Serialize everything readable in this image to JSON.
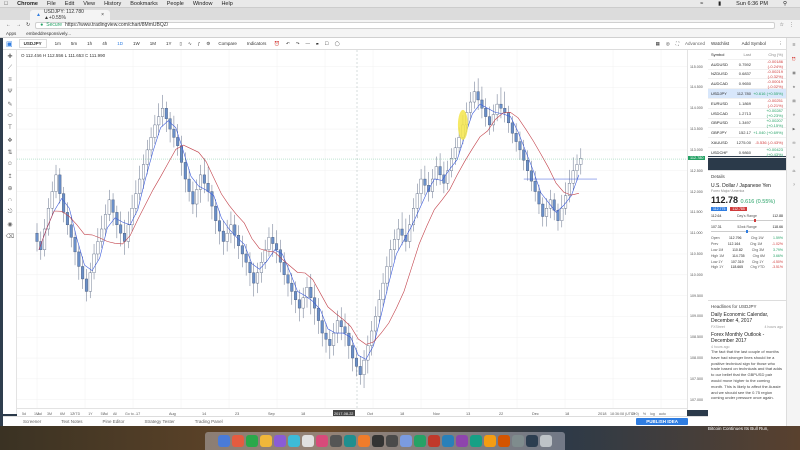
{
  "menubar": {
    "items": [
      "Chrome",
      "File",
      "Edit",
      "View",
      "History",
      "Bookmarks",
      "People",
      "Window",
      "Help"
    ],
    "clock": "Sun 6:36 PM"
  },
  "browser": {
    "tab_title": "USDJPY: 112.780 ▲+0.55%",
    "url_secure": "Secure",
    "url": "https://www.tradingview.com/chart/8MmUBQZ/",
    "bookmarks": [
      "Apps",
      "embeddresponsively..."
    ]
  },
  "toolbar": {
    "symbol": "USDJPY",
    "intervals": [
      "1m",
      "5m",
      "1h",
      "4h",
      "1D",
      "1W",
      "1M",
      "1Y"
    ],
    "compare": "Compare",
    "indicators": "Indicators",
    "advanced": "Advanced"
  },
  "ohlc": "O 112.456  H 112.556  L 111.653  C 111.990",
  "timeline": {
    "labels": [
      "Jul",
      "12",
      "Jul",
      "17",
      "Aug",
      "14",
      "23",
      "Sep",
      "18",
      "2017-08-22",
      "Oct",
      "18",
      "Nov",
      "13",
      "22",
      "Dec",
      "18",
      "2018",
      "15"
    ],
    "ranges": [
      "5d",
      "1M",
      "3M",
      "6M",
      "YTD",
      "1Y",
      "5Y",
      "All",
      "Go to..."
    ],
    "clock_readout": "18:36:08 (UTC+0)",
    "scale_opts": [
      "%",
      "log",
      "auto"
    ]
  },
  "price_axis": [
    "115.000",
    "114.500",
    "114.000",
    "113.500",
    "113.000",
    "112.500",
    "112.000",
    "111.500",
    "111.000",
    "110.500",
    "110.000",
    "109.500",
    "109.000",
    "108.500",
    "108.000",
    "107.500",
    "107.000"
  ],
  "price_tag": "112.780",
  "bottombar": {
    "items": [
      "Screener",
      "Text Notes",
      "Pine Editor",
      "Strategy Tester",
      "Trading Panel"
    ],
    "publish": "PUBLISH IDEA"
  },
  "watchlist": {
    "title": "Watchlist",
    "add": "Add Symbol",
    "headers": [
      "Symbol",
      "Last",
      "Chg (%)"
    ],
    "rows": [
      {
        "s": "AUDUSD",
        "l": "0.7592",
        "c": "-0.00186 (-0.24%)",
        "pos": false
      },
      {
        "s": "NZDUSD",
        "l": "0.6837",
        "c": "-0.00219 (-0.32%)",
        "pos": false
      },
      {
        "s": "AUDCAD",
        "l": "0.9650",
        "c": "-0.00019 (-0.02%)",
        "pos": false
      },
      {
        "s": "USDJPY",
        "l": "112.780",
        "c": "+0.616 (+0.55%)",
        "pos": true,
        "sel": true
      },
      {
        "s": "EURUSD",
        "l": "1.1869",
        "c": "-0.00251 (-0.21%)",
        "pos": false
      },
      {
        "s": "USDCAD",
        "l": "1.2713",
        "c": "+0.00287 (+0.23%)",
        "pos": true
      },
      {
        "s": "GBPUSD",
        "l": "1.3497",
        "c": "+0.00207 (+0.15%)",
        "pos": true
      },
      {
        "s": "GBPJPY",
        "l": "152.17",
        "c": "+1.040 (+0.69%)",
        "pos": true
      },
      {
        "s": "XAUUSD",
        "l": "1275.00",
        "c": "-5.536 (-0.43%)",
        "pos": false
      },
      {
        "s": "USDCHF",
        "l": "0.9860",
        "c": "+0.00423 (+0.43%)",
        "pos": true
      }
    ]
  },
  "details": {
    "title": "Details",
    "name": "U.S. Dollar / Japanese Yen",
    "exchange": "Forex Major/ America",
    "price": "112.78",
    "change": "0.616 (0.55%)",
    "bid": "112.775",
    "ask": "112.785",
    "day_low": "112.64",
    "day_high": "112.88",
    "day_range_label": "Day's Range",
    "yr_low": "107.31",
    "yr_high": "118.66",
    "yr_range_label": "52wk Range",
    "stats": [
      [
        "Open",
        "112.796",
        "Chg 1W",
        "1.59%"
      ],
      [
        "Prev",
        "112.164",
        "Chg 1M",
        "-1.02%"
      ],
      [
        "Low 1M",
        "110.82",
        "Chg 3M",
        "3.79%"
      ],
      [
        "High 1M",
        "114.735",
        "Chg 6M",
        "3.66%"
      ],
      [
        "Low 1Y",
        "107.319",
        "Chg 1Y",
        "-4.50%"
      ],
      [
        "High 1Y",
        "118.665",
        "Chg YTD",
        "-3.51%"
      ]
    ]
  },
  "headlines": {
    "title": "Headlines for USDJPY",
    "items": [
      {
        "t": "Daily Economic Calendar, December 4, 2017",
        "src": "FXStreet",
        "ago": "4 hours ago"
      },
      {
        "t": "Forex Monthly Outlook - December 2017",
        "src": "",
        "ago": "4 hours ago",
        "body": "The fact that the last couple of months have had stronger lines should be a positive technical sign for those who trade based on technicals and that adds to our belief that the GBPUSD pair would move higher to the coming month. This is likely to affect the Aussie and we should see the 0.75 region coming under pressure once again."
      },
      {
        "t": "Bitcoin Continues Its Bull Run,",
        "src": "",
        "ago": ""
      }
    ]
  },
  "chart_data": {
    "type": "candlestick",
    "title": "",
    "ylim": [
      106.8,
      115.4
    ],
    "x": "weekly-ish bars, Jun 2017 to Dec 2017",
    "candles": [
      [
        111.0,
        110.6,
        111.3,
        110.3
      ],
      [
        110.6,
        111.6,
        111.9,
        110.4
      ],
      [
        111.6,
        112.4,
        112.7,
        111.4
      ],
      [
        112.4,
        111.5,
        112.6,
        111.2
      ],
      [
        111.5,
        110.9,
        111.8,
        110.6
      ],
      [
        110.9,
        110.2,
        111.1,
        109.8
      ],
      [
        110.2,
        109.6,
        110.5,
        109.3
      ],
      [
        109.6,
        110.5,
        110.8,
        109.4
      ],
      [
        110.5,
        111.1,
        111.5,
        110.3
      ],
      [
        111.1,
        111.8,
        112.1,
        110.9
      ],
      [
        111.8,
        111.2,
        112.0,
        110.8
      ],
      [
        111.2,
        110.8,
        111.6,
        110.4
      ],
      [
        110.8,
        111.6,
        112.0,
        110.6
      ],
      [
        111.6,
        112.3,
        112.7,
        111.4
      ],
      [
        112.3,
        113.0,
        113.3,
        112.0
      ],
      [
        113.0,
        113.6,
        113.9,
        112.8
      ],
      [
        113.6,
        114.0,
        114.4,
        113.3
      ],
      [
        114.0,
        113.5,
        114.2,
        113.1
      ],
      [
        113.5,
        113.1,
        113.9,
        112.8
      ],
      [
        113.1,
        112.3,
        113.4,
        111.9
      ],
      [
        112.3,
        111.7,
        112.6,
        111.4
      ],
      [
        111.7,
        112.4,
        112.7,
        111.3
      ],
      [
        112.4,
        112.0,
        112.9,
        111.7
      ],
      [
        112.0,
        111.3,
        112.2,
        110.9
      ],
      [
        111.3,
        110.8,
        111.6,
        110.4
      ],
      [
        110.8,
        111.2,
        111.6,
        110.5
      ],
      [
        111.2,
        110.7,
        111.5,
        110.3
      ],
      [
        110.7,
        110.3,
        111.0,
        109.9
      ],
      [
        110.3,
        109.8,
        110.6,
        109.4
      ],
      [
        109.8,
        110.3,
        110.6,
        109.5
      ],
      [
        110.3,
        110.9,
        111.2,
        110.1
      ],
      [
        110.9,
        110.6,
        111.3,
        110.2
      ],
      [
        110.6,
        110.0,
        110.9,
        109.7
      ],
      [
        110.0,
        109.6,
        110.3,
        109.2
      ],
      [
        109.6,
        109.2,
        109.9,
        108.8
      ],
      [
        109.2,
        109.7,
        110.0,
        108.9
      ],
      [
        109.7,
        109.2,
        110.1,
        108.7
      ],
      [
        109.2,
        108.6,
        109.5,
        108.2
      ],
      [
        108.6,
        108.3,
        108.9,
        107.9
      ],
      [
        108.3,
        108.9,
        109.2,
        108.0
      ],
      [
        108.9,
        108.6,
        109.3,
        108.2
      ],
      [
        108.6,
        108.0,
        108.9,
        107.6
      ],
      [
        108.0,
        107.6,
        108.3,
        107.3
      ],
      [
        107.6,
        108.3,
        108.6,
        107.2
      ],
      [
        108.3,
        109.0,
        109.3,
        108.0
      ],
      [
        109.0,
        109.8,
        110.1,
        108.8
      ],
      [
        109.8,
        110.6,
        110.9,
        109.5
      ],
      [
        110.6,
        111.1,
        111.4,
        110.3
      ],
      [
        111.1,
        110.8,
        111.6,
        110.5
      ],
      [
        110.8,
        111.6,
        111.9,
        110.6
      ],
      [
        111.6,
        112.3,
        112.6,
        111.3
      ],
      [
        112.3,
        112.0,
        112.7,
        111.7
      ],
      [
        112.0,
        112.6,
        112.9,
        111.8
      ],
      [
        112.6,
        112.2,
        113.0,
        111.9
      ],
      [
        112.2,
        112.8,
        113.1,
        112.0
      ],
      [
        112.8,
        113.3,
        113.6,
        112.6
      ],
      [
        113.3,
        113.9,
        114.2,
        113.1
      ],
      [
        113.9,
        114.4,
        114.7,
        113.7
      ],
      [
        114.4,
        114.0,
        114.8,
        113.7
      ],
      [
        114.0,
        113.6,
        114.3,
        113.3
      ],
      [
        113.6,
        114.1,
        114.4,
        113.4
      ],
      [
        114.1,
        113.9,
        114.6,
        113.6
      ],
      [
        113.9,
        113.4,
        114.1,
        113.1
      ],
      [
        113.4,
        113.0,
        113.7,
        112.7
      ],
      [
        113.0,
        112.5,
        113.3,
        112.2
      ],
      [
        112.5,
        112.0,
        112.8,
        111.7
      ],
      [
        112.0,
        111.4,
        112.2,
        111.1
      ],
      [
        111.4,
        111.8,
        112.1,
        111.1
      ],
      [
        111.8,
        111.3,
        112.0,
        111.0
      ],
      [
        111.3,
        111.9,
        112.3,
        111.1
      ],
      [
        111.9,
        112.5,
        112.9,
        111.7
      ],
      [
        112.5,
        112.8,
        113.1,
        112.2
      ]
    ],
    "series": [
      {
        "name": "",
        "color": "#3b5bdb"
      },
      {
        "name": "",
        "color": "#c2414a"
      }
    ]
  }
}
